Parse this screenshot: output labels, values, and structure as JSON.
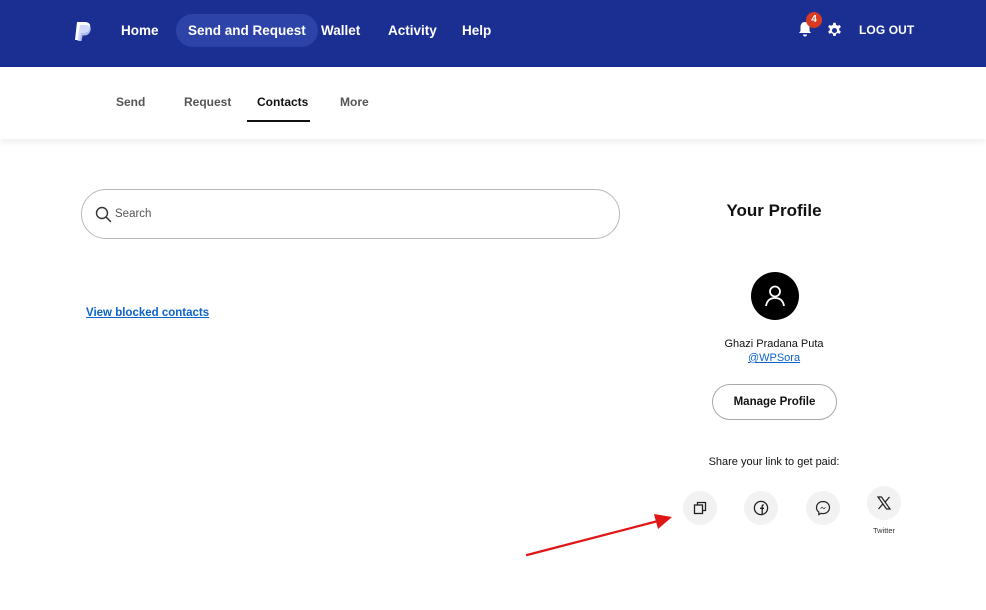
{
  "nav": {
    "links": [
      {
        "label": "Home"
      },
      {
        "label": "Send and Request"
      },
      {
        "label": "Wallet"
      },
      {
        "label": "Activity"
      },
      {
        "label": "Help"
      }
    ],
    "notification_count": "4",
    "logout_label": "LOG OUT",
    "brand_color": "#1b2f93",
    "active_pill_color": "#2d43a8",
    "badge_color": "#d83a22"
  },
  "subnav": {
    "tabs": [
      {
        "label": "Send"
      },
      {
        "label": "Request"
      },
      {
        "label": "Contacts"
      },
      {
        "label": "More"
      }
    ],
    "active_tab": "Contacts"
  },
  "search": {
    "placeholder": "Search",
    "value": ""
  },
  "blocked_link": "View blocked contacts",
  "profile": {
    "title": "Your Profile",
    "name": "Ghazi Pradana Puta",
    "handle": "@WPSora",
    "manage_label": "Manage Profile",
    "share_label": "Share your link to get paid:",
    "share_options": [
      {
        "icon": "copy-icon"
      },
      {
        "icon": "facebook-icon"
      },
      {
        "icon": "messenger-icon"
      },
      {
        "icon": "x-twitter-icon",
        "label": "Twitter"
      }
    ]
  },
  "annotation": {
    "arrow_color": "#e01515"
  }
}
